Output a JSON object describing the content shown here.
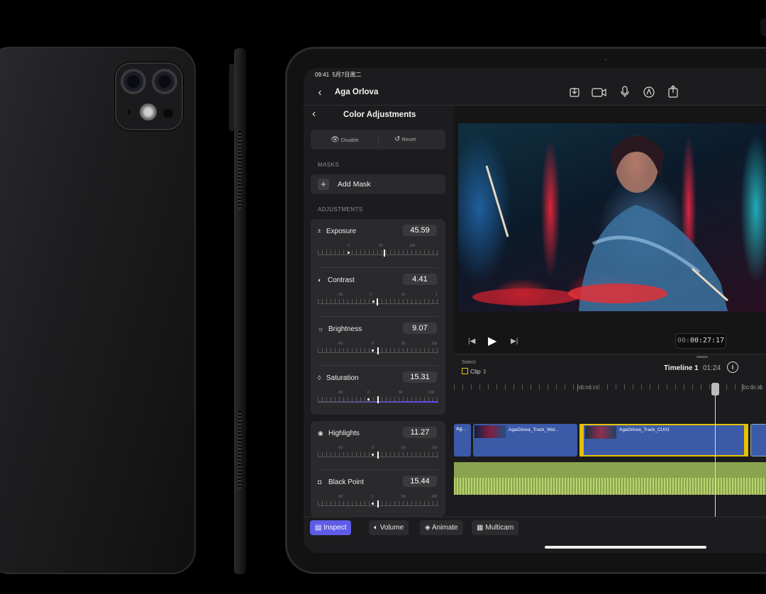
{
  "status": {
    "time": "09:41",
    "date": "5月7日周二"
  },
  "nav": {
    "title": "Aga Orlova",
    "icons": [
      "download-icon",
      "camera-icon",
      "mic-icon",
      "pen-icon",
      "share-icon"
    ]
  },
  "panel": {
    "title": "Color Adjustments",
    "disable": "Disable",
    "reset": "Reset",
    "masks_label": "MASKS",
    "add_mask": "Add Mask",
    "adjustments_label": "ADJUSTMENTS",
    "items": [
      {
        "name": "Exposure",
        "value": "45.59",
        "scale": [
          "0",
          "50",
          "100"
        ],
        "level": 0.55
      },
      {
        "name": "Contrast",
        "value": "4.41",
        "scale": [
          "-50",
          "0",
          "50",
          "1"
        ],
        "level": 0.52
      },
      {
        "name": "Brightness",
        "value": "9.07",
        "scale": [
          "-50",
          "0",
          "50",
          "100"
        ],
        "level": 0.53
      },
      {
        "name": "Saturation",
        "value": "15.31",
        "scale": [
          "-50",
          "0",
          "50",
          "100"
        ],
        "level": 0.55
      },
      {
        "name": "Highlights",
        "value": "11.27",
        "scale": [
          "-50",
          "0",
          "50",
          "100"
        ],
        "level": 0.53
      },
      {
        "name": "Black Point",
        "value": "15.44",
        "scale": [
          "-50",
          "0",
          "50",
          "100"
        ],
        "level": 0.53
      }
    ]
  },
  "transport": {
    "timecode_dim": "00:",
    "timecode": "00:27:17"
  },
  "timeline": {
    "select_label": "Select",
    "select_value": "Clip",
    "name": "Timeline 1",
    "duration": "01:24",
    "marker1": "00:00:15",
    "marker2": "00:00:30",
    "clips": [
      "Ag...",
      "AgaOrlova_Track_Wid...",
      "AgaOrlova_Track_CU03"
    ]
  },
  "toolbar": {
    "inspect": "Inspect",
    "volume": "Volume",
    "animate": "Animate",
    "multicam": "Multicam"
  },
  "colors": {
    "accent": "#5e5ce6",
    "clip": "#3b5aa8",
    "audio": "#8aa34e",
    "selected_clip_border": "#e5c100"
  }
}
